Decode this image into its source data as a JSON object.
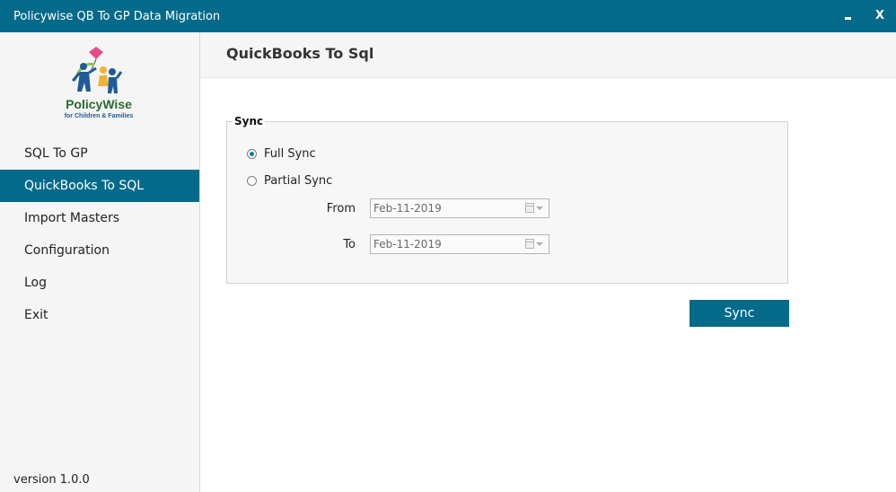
{
  "window": {
    "title": "Policywise QB To GP Data Migration",
    "minimize_label": "",
    "close_label": "X"
  },
  "logo": {
    "brand": "PolicyWise",
    "tagline": "for Children & Families",
    "colors": [
      "#1f5a99",
      "#2a6a33",
      "#8bc34a",
      "#e94b8a",
      "#f2b233"
    ]
  },
  "sidebar": {
    "items": [
      {
        "label": "SQL To GP"
      },
      {
        "label": "QuickBooks To SQL"
      },
      {
        "label": "Import Masters"
      },
      {
        "label": "Configuration"
      },
      {
        "label": "Log"
      },
      {
        "label": "Exit"
      }
    ],
    "active_index": 1,
    "version": "version 1.0.0"
  },
  "header": {
    "title": "QuickBooks To Sql"
  },
  "sync_group": {
    "label": "Sync",
    "options": [
      {
        "label": "Full Sync",
        "checked": true
      },
      {
        "label": "Partial Sync",
        "checked": false
      }
    ],
    "from": {
      "label": "From",
      "value": "Feb-11-2019"
    },
    "to": {
      "label": "To",
      "value": "Feb-11-2019"
    }
  },
  "actions": {
    "sync_label": "Sync"
  },
  "colors": {
    "accent": "#046a8a",
    "sidebar_bg": "#f5f5f5",
    "radio_fill": "#0a7fa2"
  }
}
